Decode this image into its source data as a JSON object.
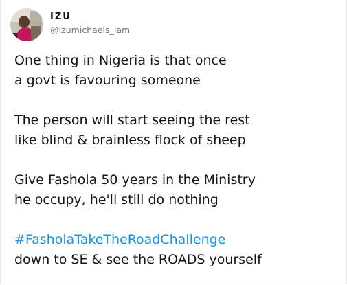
{
  "user": {
    "display_name": "IZU",
    "handle": "@Izumichaels_Iam",
    "avatar_icon": "profile-photo-avatar"
  },
  "tweet": {
    "paragraphs": [
      [
        "One thing in Nigeria is that once",
        "a govt is favouring someone"
      ],
      [
        "The person will start seeing the rest",
        "like blind & brainless flock of sheep"
      ],
      [
        "Give Fashola 50 years in the Ministry",
        "he occupy, he'll still do nothing"
      ]
    ],
    "hashtag": "#FasholaTakeTheRoadChallenge",
    "closing_line": "down to SE & see the ROADS yourself"
  },
  "colors": {
    "text": "#14171a",
    "secondary": "#657786",
    "link": "#1b95e0",
    "border": "#e1e8ed"
  }
}
